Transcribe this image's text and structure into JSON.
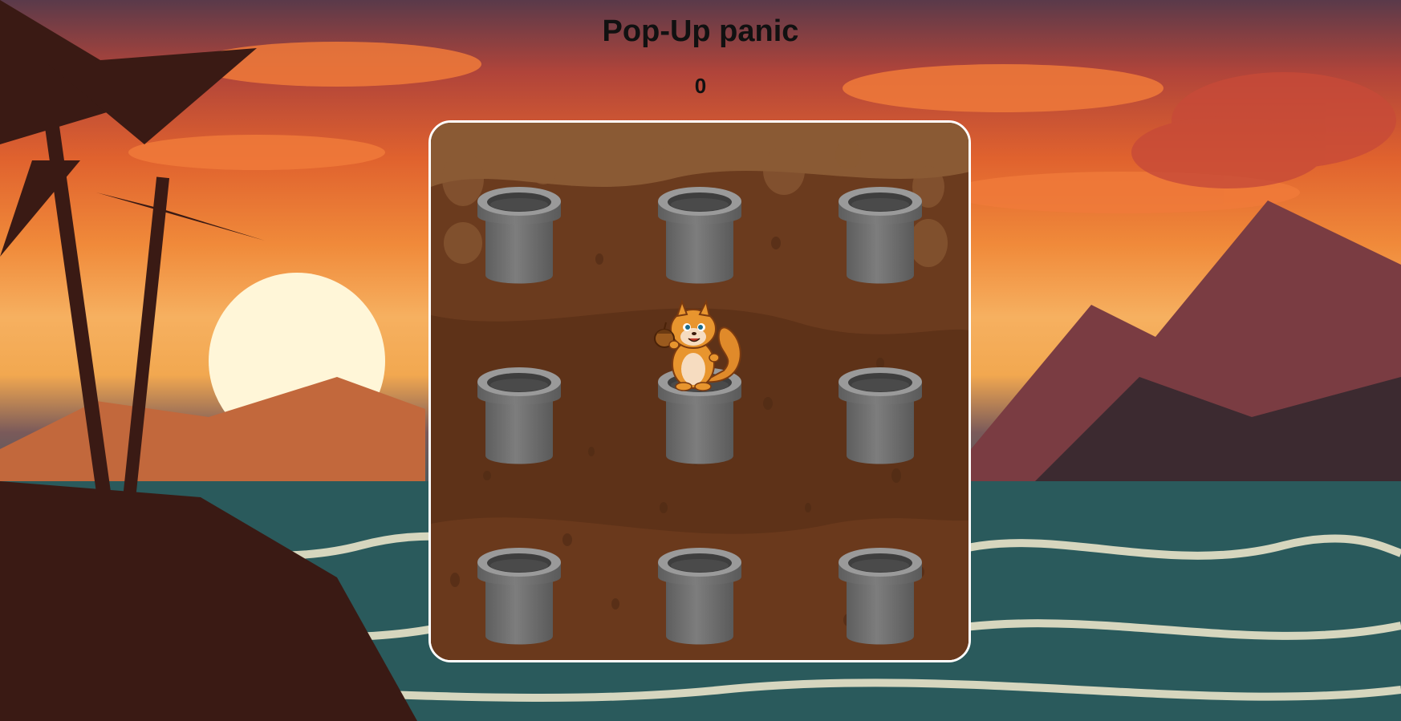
{
  "game": {
    "title": "Pop-Up panic",
    "score": "0"
  },
  "board": {
    "rows": 3,
    "cols": 3,
    "active_hole": 4,
    "pipe_color": "#7d7d7d",
    "dirt_color": "#6b3b1e"
  },
  "character": {
    "name": "squirrel",
    "icon": "squirrel-holding-acorn"
  }
}
